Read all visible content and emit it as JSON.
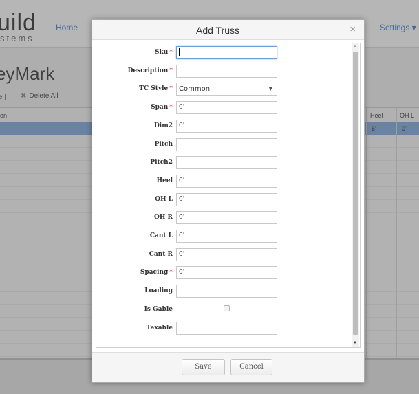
{
  "background": {
    "brand_main": "uild",
    "brand_sub": "stems",
    "nav_home": "Home",
    "nav_settings": "Settings",
    "settings_arrow": "▾",
    "page_title": "eyMark",
    "toolbar": {
      "separator": "e |",
      "delete_all": "Delete All",
      "delete_icon": "✖"
    },
    "grid": {
      "columns": [
        "on",
        "Heel",
        "OH L"
      ],
      "selected_row": {
        "heel": "6'",
        "oh_l": "0'"
      }
    }
  },
  "modal": {
    "title": "Add Truss",
    "close_glyph": "×",
    "fields": [
      {
        "label": "Sku",
        "required": true,
        "type": "text",
        "value": "",
        "focused": true
      },
      {
        "label": "Description",
        "required": true,
        "type": "text",
        "value": ""
      },
      {
        "label": "TC Style",
        "required": true,
        "type": "select",
        "value": "Common"
      },
      {
        "label": "Span",
        "required": true,
        "type": "text",
        "value": "0'"
      },
      {
        "label": "Dim2",
        "required": false,
        "type": "text",
        "value": "0'"
      },
      {
        "label": "Pitch",
        "required": false,
        "type": "text",
        "value": ""
      },
      {
        "label": "Pitch2",
        "required": false,
        "type": "text",
        "value": ""
      },
      {
        "label": "Heel",
        "required": false,
        "type": "text",
        "value": "0'"
      },
      {
        "label": "OH L",
        "required": false,
        "type": "text",
        "value": "0'"
      },
      {
        "label": "OH R",
        "required": false,
        "type": "text",
        "value": "0'"
      },
      {
        "label": "Cant L",
        "required": false,
        "type": "text",
        "value": "0'"
      },
      {
        "label": "Cant R",
        "required": false,
        "type": "text",
        "value": "0'"
      },
      {
        "label": "Spacing",
        "required": true,
        "type": "text",
        "value": "0'"
      },
      {
        "label": "Loading",
        "required": false,
        "type": "text",
        "value": ""
      },
      {
        "label": "Is Gable",
        "required": false,
        "type": "checkbox",
        "checked": false
      },
      {
        "label": "Taxable",
        "required": false,
        "type": "text",
        "value": ""
      }
    ],
    "required_marker": "*",
    "select_arrow": "▼",
    "buttons": {
      "save": "Save",
      "cancel": "Cancel"
    }
  },
  "colors": {
    "required": "#e03c3c",
    "link": "#3a7fd5",
    "selected_row": "#7fa8dc"
  }
}
